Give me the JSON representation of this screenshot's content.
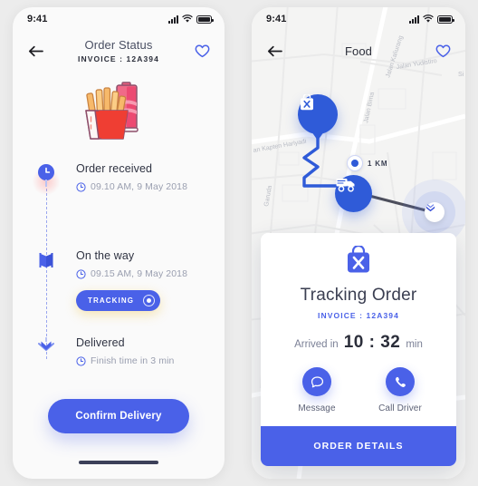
{
  "left_screen": {
    "status_bar": {
      "time": "9:41",
      "signal_icon": "signal-bars-icon",
      "wifi_icon": "wifi-icon",
      "battery_icon": "battery-icon"
    },
    "nav": {
      "back_icon": "arrow-left-icon",
      "title": "Order Status",
      "subtitle": "INVOICE : 12A394",
      "favorite_icon": "heart-outline-icon"
    },
    "hero_illustration": "fries-and-soda-illustration",
    "timeline": [
      {
        "icon": "clock-pin-icon",
        "title": "Order received",
        "meta_icon": "clock-icon",
        "meta": "09.10 AM, 9 May 2018",
        "badge": null
      },
      {
        "icon": "map-pin-icon",
        "title": "On the way",
        "meta_icon": "clock-icon",
        "meta": "09.15 AM, 9 May 2018",
        "badge": {
          "label": "TRACKING",
          "indicator_icon": "radio-dot-icon"
        }
      },
      {
        "icon": "delivered-chevron-icon",
        "title": "Delivered",
        "meta_icon": "clock-icon",
        "meta": "Finish time in 3 min",
        "badge": null
      }
    ],
    "confirm_button": "Confirm Delivery",
    "home_indicator": "home-indicator"
  },
  "right_screen": {
    "status_bar": {
      "time": "9:41",
      "signal_icon": "signal-bars-icon",
      "wifi_icon": "wifi-icon",
      "battery_icon": "battery-icon"
    },
    "nav": {
      "back_icon": "arrow-left-icon",
      "title": "Food",
      "favorite_icon": "heart-outline-icon"
    },
    "map": {
      "road_labels": [
        "Jalan Kaliurang",
        "Jalan Bima",
        "Jalan Yudistiro",
        "Jalan Kapten Hariyadi",
        "Garuda",
        "Si"
      ],
      "markers": {
        "restaurant_icon": "food-bag-icon",
        "courier_icon": "delivery-truck-icon",
        "destination_icon": "destination-marker-icon"
      },
      "distance_chip": {
        "icon": "radio-dot-icon",
        "label": "1 KM"
      }
    },
    "tracking_card": {
      "icon": "food-bag-icon",
      "title": "Tracking Order",
      "invoice": "INVOICE : 12A394",
      "eta_prefix": "Arrived in",
      "eta_value": "10 : 32",
      "eta_suffix": "min",
      "actions": [
        {
          "icon": "message-bubble-icon",
          "label": "Message"
        },
        {
          "icon": "phone-icon",
          "label": "Call Driver"
        }
      ],
      "cta": "ORDER DETAILS"
    }
  },
  "colors": {
    "accent_blue": "#4a61e8",
    "marker_blue": "#2f5bd8",
    "text_dark": "#2b2e3a",
    "text_muted": "#9a9fb0",
    "screen_bg": "#fafafa",
    "page_bg": "#ececec",
    "fries_red": "#ef3e33",
    "soda_pink": "#f2607f"
  }
}
